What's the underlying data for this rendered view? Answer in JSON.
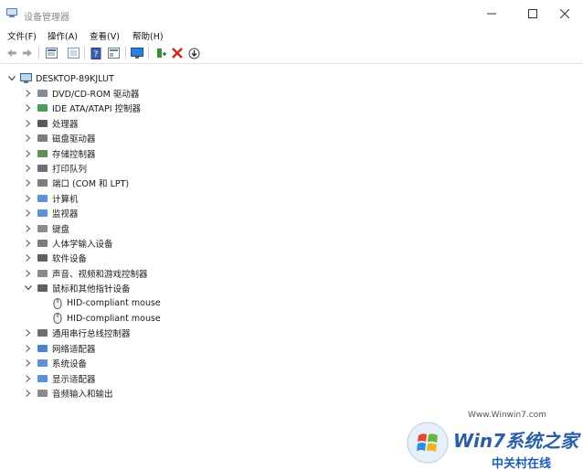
{
  "window": {
    "title": "设备管理器",
    "minimize_icon": "minimize-icon",
    "maximize_icon": "maximize-icon",
    "close_icon": "close-icon"
  },
  "menu": [
    {
      "label": "文件(F)"
    },
    {
      "label": "操作(A)"
    },
    {
      "label": "查看(V)"
    },
    {
      "label": "帮助(H)"
    }
  ],
  "toolbar": {
    "icons": [
      "back-arrow-icon",
      "forward-arrow-icon",
      "properties-icon",
      "show-hidden-icon",
      "help-icon",
      "view-icon",
      "monitor-scan-icon",
      "enable-device-icon",
      "uninstall-x-icon",
      "update-driver-icon"
    ]
  },
  "tree": {
    "root": "DESKTOP-89KJLUT",
    "categories": [
      {
        "label": "DVD/CD-ROM 驱动器",
        "icon": "dvd-drive-icon"
      },
      {
        "label": "IDE ATA/ATAPI 控制器",
        "icon": "ide-controller-icon"
      },
      {
        "label": "处理器",
        "icon": "processor-icon"
      },
      {
        "label": "磁盘驱动器",
        "icon": "disk-drive-icon"
      },
      {
        "label": "存储控制器",
        "icon": "storage-controller-icon"
      },
      {
        "label": "打印队列",
        "icon": "printer-icon"
      },
      {
        "label": "端口 (COM 和 LPT)",
        "icon": "port-icon"
      },
      {
        "label": "计算机",
        "icon": "computer-icon"
      },
      {
        "label": "监视器",
        "icon": "monitor-icon"
      },
      {
        "label": "键盘",
        "icon": "keyboard-icon"
      },
      {
        "label": "人体学输入设备",
        "icon": "hid-icon"
      },
      {
        "label": "软件设备",
        "icon": "software-device-icon"
      },
      {
        "label": "声音、视频和游戏控制器",
        "icon": "sound-icon"
      },
      {
        "label": "鼠标和其他指针设备",
        "icon": "mouse-icon",
        "expanded": true,
        "children": [
          "HID-compliant mouse",
          "HID-compliant mouse"
        ]
      },
      {
        "label": "通用串行总线控制器",
        "icon": "usb-icon"
      },
      {
        "label": "网络适配器",
        "icon": "network-adapter-icon"
      },
      {
        "label": "系统设备",
        "icon": "system-device-icon"
      },
      {
        "label": "显示适配器",
        "icon": "display-adapter-icon"
      },
      {
        "label": "音频输入和输出",
        "icon": "audio-io-icon"
      }
    ]
  },
  "watermark": {
    "text": "Win7系统之家",
    "url": "Www.Winwin7.com",
    "text2": "中关村在线"
  }
}
